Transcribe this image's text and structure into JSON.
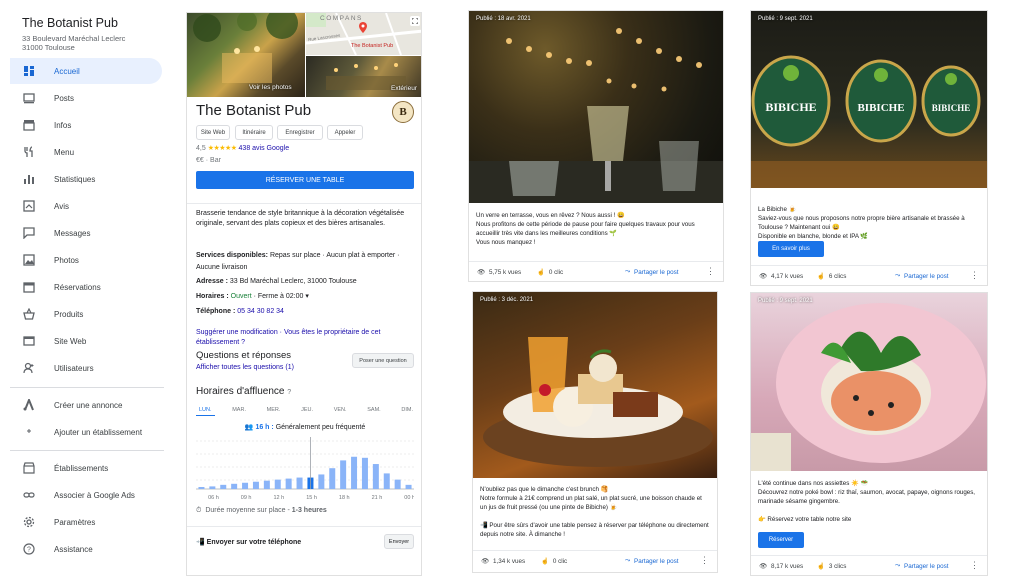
{
  "business": {
    "name": "The Botanist Pub",
    "address_line1": "33 Boulevard Maréchal Leclerc",
    "address_line2": "31000 Toulouse"
  },
  "nav": {
    "items": [
      {
        "label": "Accueil",
        "icon": "home-icon",
        "active": true
      },
      {
        "label": "Posts",
        "icon": "posts-icon"
      },
      {
        "label": "Infos",
        "icon": "store-icon"
      },
      {
        "label": "Menu",
        "icon": "restaurant-icon"
      },
      {
        "label": "Statistiques",
        "icon": "bar-chart-icon"
      },
      {
        "label": "Avis",
        "icon": "reviews-icon"
      },
      {
        "label": "Messages",
        "icon": "chat-icon"
      },
      {
        "label": "Photos",
        "icon": "photo-icon"
      },
      {
        "label": "Réservations",
        "icon": "calendar-icon"
      },
      {
        "label": "Produits",
        "icon": "basket-icon"
      },
      {
        "label": "Site Web",
        "icon": "web-icon"
      },
      {
        "label": "Utilisateurs",
        "icon": "add-user-icon"
      }
    ],
    "secondary": [
      {
        "label": "Créer une annonce",
        "icon": "ads-icon"
      },
      {
        "label": "Ajouter un établissement",
        "icon": "add-location-icon"
      }
    ],
    "tertiary": [
      {
        "label": "Établissements",
        "icon": "storefront-icon"
      },
      {
        "label": "Associer à Google Ads",
        "icon": "link-icon"
      },
      {
        "label": "Paramètres",
        "icon": "settings-icon"
      },
      {
        "label": "Assistance",
        "icon": "help-icon"
      }
    ]
  },
  "panel": {
    "map_label": "COMPANS",
    "map_pin_label": "The Botanist Pub",
    "map_street": "Rue Lascrosses",
    "photo_label": "Voir les photos",
    "exterior_label": "Extérieur",
    "title": "The Botanist Pub",
    "logo_letter": "B",
    "chips": [
      "Site Web",
      "Itinéraire",
      "Enregistrer",
      "Appeler"
    ],
    "rating_value": "4,5",
    "stars": "★★★★★",
    "reviews_link": "438 avis Google",
    "price": "€€",
    "category": "Bar",
    "reserve_button": "RÉSERVER UNE TABLE",
    "description": "Brasserie tendance de style britannique à la décoration végétalisée originale, servant des plats copieux et des bières artisanales.",
    "services_label": "Services disponibles:",
    "services_value": "Repas sur place · Aucun plat à emporter · Aucune livraison",
    "address_label": "Adresse :",
    "address_value": "33 Bd Maréchal Leclerc, 31000 Toulouse",
    "hours_label": "Horaires :",
    "hours_open": "Ouvert",
    "hours_close": "· Ferme à 02:00",
    "phone_label": "Téléphone :",
    "phone_value": "05 34 30 82 34",
    "suggest_link": "Suggérer une modification",
    "owner_link": "Vous êtes le propriétaire de cet établissement ?",
    "qa_title": "Questions et réponses",
    "qa_link": "Afficher toutes les questions (1)",
    "qa_button": "Poser une question",
    "popular_title": "Horaires d'affluence",
    "days": [
      "LUN.",
      "MAR.",
      "MER.",
      "JEU.",
      "VEN.",
      "SAM.",
      "DIM."
    ],
    "live_time": "16 h :",
    "live_text": "Généralement peu fréquenté",
    "hour_labels": [
      "06 h",
      "09 h",
      "12 h",
      "15 h",
      "18 h",
      "21 h",
      "00 h"
    ],
    "duration_label": "Durée moyenne sur place -",
    "duration_value": "1-3 heures",
    "send_label": "Envoyer sur votre téléphone",
    "send_button": "Envoyer"
  },
  "chart_data": {
    "type": "bar",
    "title": "Horaires d'affluence",
    "categories": [
      "06 h",
      "07 h",
      "08 h",
      "09 h",
      "10 h",
      "11 h",
      "12 h",
      "13 h",
      "14 h",
      "15 h",
      "16 h",
      "17 h",
      "18 h",
      "19 h",
      "20 h",
      "21 h",
      "22 h",
      "23 h",
      "00 h",
      "01 h"
    ],
    "values": [
      0,
      5,
      8,
      10,
      12,
      14,
      16,
      18,
      20,
      22,
      22,
      28,
      40,
      55,
      62,
      60,
      48,
      30,
      18,
      8
    ],
    "ylim": [
      0,
      100
    ],
    "highlight_category": "16 h"
  },
  "posts": [
    {
      "date": "Publié : 18 avr. 2021",
      "text": "Un verre en terrasse, vous en rêvez ? Nous aussi ! 😀\nNous profitons de cette période de pause pour faire quelques travaux pour vous accueillir très vite dans les meilleures conditions 🌱\nVous nous manquez !",
      "views": "5,75 k vues",
      "clicks": "0 clic",
      "share": "Partager le post"
    },
    {
      "date": "Publié : 9 sept. 2021",
      "text": "La Bibiche 🍺\nSaviez-vous que nous proposons notre propre bière artisanale et brassée à Toulouse ? Maintenant oui 😀\nDisponible en blanche, blonde et IPA 🌿",
      "button": "En savoir plus",
      "views": "4,17 k vues",
      "clicks": "6 clics",
      "share": "Partager le post"
    },
    {
      "date": "Publié : 3 déc. 2021",
      "text": "N'oubliez pas que le dimanche c'est brunch 🥞\nNotre formule à 21€ comprend un plat salé, un plat sucré, une boisson chaude et un jus de fruit pressé (ou une pinte de Bibiche) 🍺\n\n📲 Pour être sûrs d'avoir une table pensez à réserver par téléphone ou directement depuis notre site. À dimanche !",
      "views": "1,34 k vues",
      "clicks": "0 clic",
      "share": "Partager le post"
    },
    {
      "date": "Publié : 9 sept. 2021",
      "text": "L'été continue dans nos assiettes ☀️ 🥗\nDécouvrez notre poké bowl : riz thaï, saumon, avocat, papaye, oignons rouges, marinade sésame gingembre.\n\n👉 Réservez votre table notre site",
      "button": "Réserver",
      "views": "8,17 k vues",
      "clicks": "3 clics",
      "share": "Partager le post"
    }
  ],
  "bibiche_labels": [
    "BIBICHE",
    "BIBICHE",
    "BIBICHE"
  ],
  "colors": {
    "accent": "#1a73e8",
    "active_nav_bg": "#e8f0fe",
    "open_green": "#188038",
    "link": "#1a0dab"
  }
}
